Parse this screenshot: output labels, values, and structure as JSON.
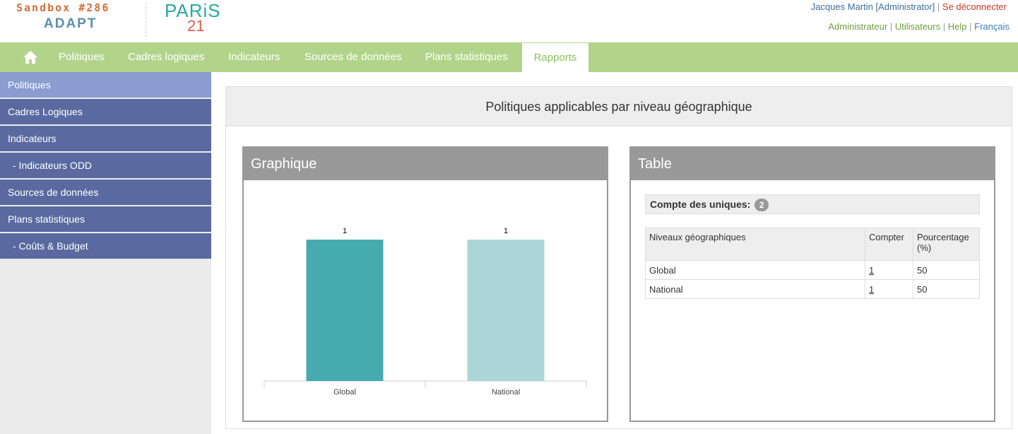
{
  "brand": {
    "sandbox": "Sandbox #286",
    "adapt": "ADAPT",
    "logo_top": "PARiS",
    "logo_bottom": "21"
  },
  "user": {
    "name": "Jacques Martin [Administrator]",
    "separator": "|",
    "logout": "Se déconnecter"
  },
  "admin_links": {
    "administrateur": "Administrateur",
    "utilisateurs": "Utilisateurs",
    "help": "Help",
    "language": "Français"
  },
  "nav": {
    "home_icon": "home-icon",
    "items": [
      {
        "label": "Politiques"
      },
      {
        "label": "Cadres logiques"
      },
      {
        "label": "Indicateurs"
      },
      {
        "label": "Sources de données"
      },
      {
        "label": "Plans statistiques"
      },
      {
        "label": "Rapports",
        "active": true
      }
    ]
  },
  "sidebar": {
    "items": [
      {
        "label": "Politiques",
        "active": true
      },
      {
        "label": "Cadres Logiques"
      },
      {
        "label": "Indicateurs"
      },
      {
        "label": "- Indicateurs ODD"
      },
      {
        "label": "Sources de données"
      },
      {
        "label": "Plans statistiques"
      },
      {
        "label": "- Coûts & Budget"
      }
    ]
  },
  "report": {
    "title": "Politiques applicables par niveau géographique"
  },
  "chart_card": {
    "title": "Graphique"
  },
  "chart_data": {
    "type": "bar",
    "categories": [
      "Global",
      "National"
    ],
    "values": [
      1,
      1
    ],
    "colors": [
      "#45abb0",
      "#acd5d8"
    ],
    "data_labels": [
      "1",
      "1"
    ],
    "ylim": [
      0,
      1
    ]
  },
  "table_card": {
    "title": "Table",
    "unique_label": "Compte des uniques:",
    "unique_count": "2",
    "headers": [
      "Niveaux géographiques",
      "Compter",
      "Pourcentage (%)"
    ],
    "rows": [
      {
        "level": "Global",
        "count": "1",
        "percent": "50"
      },
      {
        "level": "National",
        "count": "1",
        "percent": "50"
      }
    ]
  },
  "colors": {
    "nav_bg": "#b2d48a",
    "sidebar_bg": "#5a6aa0",
    "sidebar_active": "#8a9cd0",
    "card_header": "#999999"
  }
}
